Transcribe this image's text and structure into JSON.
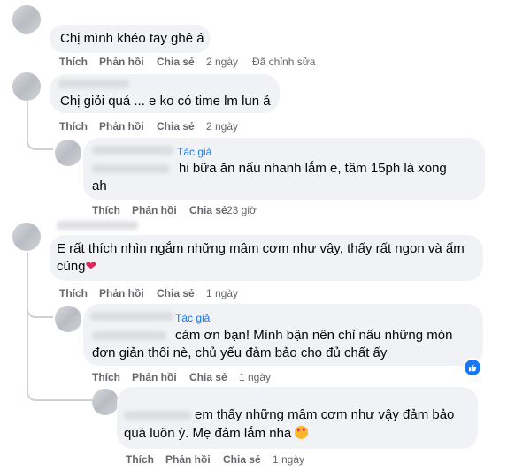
{
  "actions": {
    "like": "Thích",
    "reply": "Phản hồi",
    "share": "Chia sẻ"
  },
  "author_badge": "Tác giả",
  "comments": [
    {
      "text": "Chị mình khéo tay ghê á",
      "time": "2 ngày",
      "edited": "Đã chỉnh sửa"
    },
    {
      "text": "Chị giỏi quá ... e ko có time lm lun á",
      "time": "2 ngày"
    },
    {
      "line1": "hi bữa ăn nấu nhanh lắm e, tầm 15ph là xong",
      "line2": "ah",
      "time": "23 giờ"
    },
    {
      "line1": "E rất thích nhìn ngắm những mâm cơm như vậy, thấy rất ngon và ấm",
      "line2": "cúng",
      "time": "1 ngày"
    },
    {
      "line1": "cám ơn bạn! Mình bận nên chỉ nấu những món",
      "line2": "đơn giản thôi nè, chủ yếu đảm bảo cho đủ chất ấy",
      "time": "1 ngày"
    },
    {
      "line1": "em thấy những mâm cơm như vậy đảm bảo",
      "line2": "quá luôn ý. Mẹ đảm lắm nha",
      "time": "1 ngày"
    }
  ],
  "icons": {
    "heart": "red-heart-icon",
    "like": "like-thumb-icon",
    "emoji": "heart-eyes-emoji-icon"
  },
  "colors": {
    "bubble": "#f0f2f5",
    "author": "#1877f2",
    "meta": "#65676b",
    "heart": "#e0245e"
  }
}
